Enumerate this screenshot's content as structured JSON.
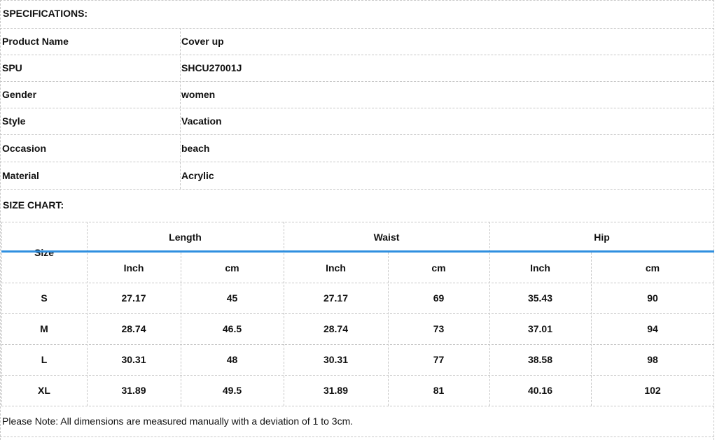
{
  "specs": {
    "heading": "SPECIFICATIONS:",
    "rows": [
      {
        "label": "Product  Name",
        "value": "Cover up"
      },
      {
        "label": "SPU",
        "value": "SHCU27001J"
      },
      {
        "label": "Gender",
        "value": "women"
      },
      {
        "label": "Style",
        "value": "Vacation"
      },
      {
        "label": "Occasion",
        "value": "beach"
      },
      {
        "label": "Material",
        "value": "Acrylic"
      }
    ]
  },
  "size_chart": {
    "heading": "SIZE CHART:",
    "size_header": "Size",
    "groups": [
      "Length",
      "Waist",
      "Hip"
    ],
    "units": [
      "Inch",
      "cm",
      "Inch",
      "cm",
      "Inch",
      "cm"
    ],
    "rows": [
      {
        "size": "S",
        "values": [
          "27.17",
          "45",
          "27.17",
          "69",
          "35.43",
          "90"
        ]
      },
      {
        "size": "M",
        "values": [
          "28.74",
          "46.5",
          "28.74",
          "73",
          "37.01",
          "94"
        ]
      },
      {
        "size": "L",
        "values": [
          "30.31",
          "48",
          "30.31",
          "77",
          "38.58",
          "98"
        ]
      },
      {
        "size": "XL",
        "values": [
          "31.89",
          "49.5",
          "31.89",
          "81",
          "40.16",
          "102"
        ]
      }
    ]
  },
  "note": "Please Note:  All dimensions are measured manually with a deviation of 1 to 3cm."
}
